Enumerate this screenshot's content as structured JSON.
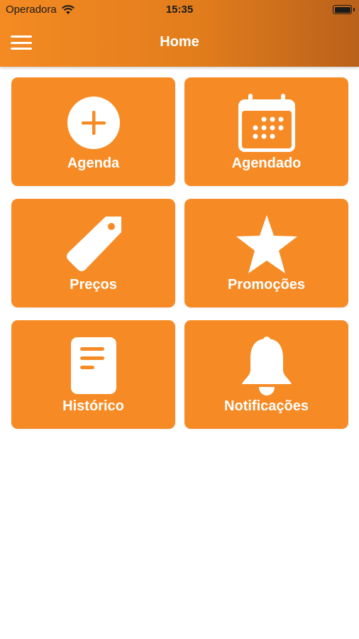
{
  "status_bar": {
    "carrier": "Operadora",
    "time": "15:35"
  },
  "header": {
    "title": "Home"
  },
  "tiles": [
    {
      "label": "Agenda",
      "icon": "plus-circle-icon"
    },
    {
      "label": "Agendado",
      "icon": "calendar-icon"
    },
    {
      "label": "Preços",
      "icon": "tag-icon"
    },
    {
      "label": "Promoções",
      "icon": "star-icon"
    },
    {
      "label": "Histórico",
      "icon": "document-icon"
    },
    {
      "label": "Notificações",
      "icon": "bell-icon"
    }
  ],
  "colors": {
    "accent": "#f68b25",
    "header_end": "#b9611b",
    "text_on_accent": "#ffffff"
  }
}
